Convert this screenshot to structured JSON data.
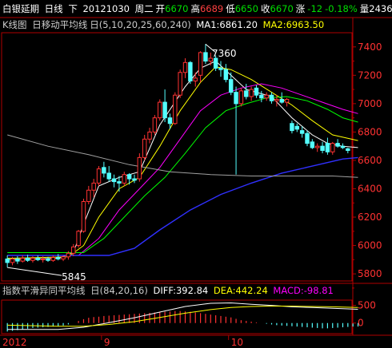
{
  "header": {
    "symbol": "白银延期",
    "period": "日线",
    "direction": "下",
    "date": "20121030",
    "weekday": "周二",
    "open_label": "开",
    "open": "6670",
    "high_label": "高",
    "high": "6689",
    "low_label": "低",
    "low": "6650",
    "close_label": "收",
    "close": "6670",
    "change_label": "涨",
    "change": "-12",
    "change_pct": "-0.18%",
    "volume_label": "量2436"
  },
  "main_indicator": {
    "name": "K线图",
    "ma_box": "日",
    "ma_name": "移动平均线",
    "ma_params": "日(5,10,20,25,60,240)",
    "ma1": "MA1:6861.20",
    "ma2": "MA2:6963.50"
  },
  "macd_indicator": {
    "name": "指数平滑异同平均线",
    "params": "日(84,20,16)",
    "diff": "DIFF:392.84",
    "dea": "DEA:442.24",
    "macd": "MACD:-98.81"
  },
  "colors": {
    "up": "#ff3232",
    "down": "#54ffff",
    "frame": "#b00000",
    "ma5": "#ffffff",
    "ma10": "#ffff00",
    "ma20": "#ff00ff",
    "ma25": "#00ff00",
    "ma60": "#3030ff",
    "ma240": "#a0a0a0"
  },
  "chart_data": {
    "type": "candlestick",
    "price_axis": {
      "range": [
        5750,
        7500
      ],
      "ticks": [
        "7400",
        "7200",
        "7000",
        "6800",
        "6600",
        "6400",
        "6200",
        "6000",
        "5800"
      ]
    },
    "macd_axis": {
      "range": [
        -300,
        650
      ],
      "ticks": [
        "500",
        "0"
      ]
    },
    "x_ticks": [
      "2012",
      "9",
      "10"
    ],
    "annotations": {
      "high": "7360",
      "low": "5845"
    },
    "candles": [
      {
        "o": 5905,
        "h": 5930,
        "l": 5845,
        "c": 5880
      },
      {
        "o": 5880,
        "h": 5920,
        "l": 5860,
        "c": 5905
      },
      {
        "o": 5905,
        "h": 5925,
        "l": 5870,
        "c": 5890
      },
      {
        "o": 5890,
        "h": 5930,
        "l": 5880,
        "c": 5910
      },
      {
        "o": 5910,
        "h": 5935,
        "l": 5885,
        "c": 5895
      },
      {
        "o": 5895,
        "h": 5925,
        "l": 5880,
        "c": 5910
      },
      {
        "o": 5910,
        "h": 5930,
        "l": 5890,
        "c": 5900
      },
      {
        "o": 5900,
        "h": 5925,
        "l": 5880,
        "c": 5905
      },
      {
        "o": 5905,
        "h": 5920,
        "l": 5885,
        "c": 5895
      },
      {
        "o": 5895,
        "h": 5930,
        "l": 5885,
        "c": 5915
      },
      {
        "o": 5915,
        "h": 5940,
        "l": 5895,
        "c": 5905
      },
      {
        "o": 5905,
        "h": 5930,
        "l": 5890,
        "c": 5920
      },
      {
        "o": 5920,
        "h": 5960,
        "l": 5900,
        "c": 5945
      },
      {
        "o": 5945,
        "h": 6010,
        "l": 5925,
        "c": 5990
      },
      {
        "o": 6000,
        "h": 6110,
        "l": 5985,
        "c": 6100
      },
      {
        "o": 6100,
        "h": 6330,
        "l": 6090,
        "c": 6310
      },
      {
        "o": 6310,
        "h": 6420,
        "l": 6290,
        "c": 6390
      },
      {
        "o": 6390,
        "h": 6470,
        "l": 6340,
        "c": 6440
      },
      {
        "o": 6440,
        "h": 6560,
        "l": 6420,
        "c": 6540
      },
      {
        "o": 6550,
        "h": 6590,
        "l": 6480,
        "c": 6510
      },
      {
        "o": 6510,
        "h": 6560,
        "l": 6450,
        "c": 6470
      },
      {
        "o": 6470,
        "h": 6500,
        "l": 6410,
        "c": 6450
      },
      {
        "o": 6450,
        "h": 6490,
        "l": 6380,
        "c": 6440
      },
      {
        "o": 6440,
        "h": 6520,
        "l": 6420,
        "c": 6500
      },
      {
        "o": 6500,
        "h": 6510,
        "l": 6430,
        "c": 6470
      },
      {
        "o": 6470,
        "h": 6500,
        "l": 6440,
        "c": 6460
      },
      {
        "o": 6470,
        "h": 6650,
        "l": 6450,
        "c": 6620
      },
      {
        "o": 6620,
        "h": 6780,
        "l": 6600,
        "c": 6750
      },
      {
        "o": 6750,
        "h": 6830,
        "l": 6720,
        "c": 6800
      },
      {
        "o": 6800,
        "h": 6920,
        "l": 6780,
        "c": 6900
      },
      {
        "o": 6900,
        "h": 7030,
        "l": 6880,
        "c": 7010
      },
      {
        "o": 7010,
        "h": 7100,
        "l": 6870,
        "c": 6900
      },
      {
        "o": 6900,
        "h": 6930,
        "l": 6820,
        "c": 6860
      },
      {
        "o": 6860,
        "h": 7080,
        "l": 6850,
        "c": 7060
      },
      {
        "o": 7060,
        "h": 7240,
        "l": 7040,
        "c": 7220
      },
      {
        "o": 7220,
        "h": 7320,
        "l": 7180,
        "c": 7290
      },
      {
        "o": 7290,
        "h": 7300,
        "l": 7140,
        "c": 7160
      },
      {
        "o": 7160,
        "h": 7220,
        "l": 7120,
        "c": 7180
      },
      {
        "o": 7200,
        "h": 7370,
        "l": 7150,
        "c": 7360
      },
      {
        "o": 7360,
        "h": 7420,
        "l": 7280,
        "c": 7300
      },
      {
        "o": 7300,
        "h": 7360,
        "l": 7270,
        "c": 7320
      },
      {
        "o": 7320,
        "h": 7340,
        "l": 7230,
        "c": 7250
      },
      {
        "o": 7250,
        "h": 7300,
        "l": 7190,
        "c": 7240
      },
      {
        "o": 7240,
        "h": 7280,
        "l": 7150,
        "c": 7170
      },
      {
        "o": 7170,
        "h": 7220,
        "l": 7060,
        "c": 7080
      },
      {
        "o": 7080,
        "h": 7120,
        "l": 6500,
        "c": 7000
      },
      {
        "o": 7000,
        "h": 7110,
        "l": 6980,
        "c": 7090
      },
      {
        "o": 7090,
        "h": 7140,
        "l": 7030,
        "c": 7050
      },
      {
        "o": 7050,
        "h": 7120,
        "l": 7020,
        "c": 7100
      },
      {
        "o": 7110,
        "h": 7130,
        "l": 7040,
        "c": 7060
      },
      {
        "o": 7060,
        "h": 7090,
        "l": 7010,
        "c": 7040
      },
      {
        "o": 7040,
        "h": 7080,
        "l": 7020,
        "c": 7060
      },
      {
        "o": 7060,
        "h": 7080,
        "l": 7000,
        "c": 7020
      },
      {
        "o": 7020,
        "h": 7060,
        "l": 6980,
        "c": 7030
      },
      {
        "o": 7030,
        "h": 7080,
        "l": 7000,
        "c": 7010
      },
      {
        "o": 7010,
        "h": 7040,
        "l": 6980,
        "c": 7030
      },
      {
        "o": 6860,
        "h": 6880,
        "l": 6790,
        "c": 6810
      },
      {
        "o": 6840,
        "h": 6860,
        "l": 6800,
        "c": 6820
      },
      {
        "o": 6810,
        "h": 6840,
        "l": 6760,
        "c": 6790
      },
      {
        "o": 6790,
        "h": 6810,
        "l": 6700,
        "c": 6720
      },
      {
        "o": 6730,
        "h": 6750,
        "l": 6680,
        "c": 6690
      },
      {
        "o": 6690,
        "h": 6720,
        "l": 6660,
        "c": 6700
      },
      {
        "o": 6700,
        "h": 6730,
        "l": 6650,
        "c": 6670
      },
      {
        "o": 6720,
        "h": 6760,
        "l": 6640,
        "c": 6660
      },
      {
        "o": 6660,
        "h": 6730,
        "l": 6640,
        "c": 6720
      },
      {
        "o": 6720,
        "h": 6750,
        "l": 6690,
        "c": 6700
      },
      {
        "o": 6700,
        "h": 6720,
        "l": 6680,
        "c": 6690
      },
      {
        "o": 6682,
        "h": 6689,
        "l": 6650,
        "c": 6670
      }
    ],
    "ma_lines": {
      "ma5": [
        [
          0,
          5900
        ],
        [
          10,
          5910
        ],
        [
          13,
          5950
        ],
        [
          15,
          6150
        ],
        [
          18,
          6420
        ],
        [
          22,
          6480
        ],
        [
          26,
          6520
        ],
        [
          30,
          6850
        ],
        [
          35,
          7120
        ],
        [
          38,
          7250
        ],
        [
          41,
          7300
        ],
        [
          44,
          7200
        ],
        [
          47,
          7100
        ],
        [
          52,
          7050
        ],
        [
          56,
          6900
        ],
        [
          60,
          6780
        ],
        [
          63,
          6720
        ],
        [
          66,
          6700
        ],
        [
          69,
          6690
        ]
      ],
      "ma10": [
        [
          0,
          5910
        ],
        [
          12,
          5920
        ],
        [
          15,
          6000
        ],
        [
          18,
          6200
        ],
        [
          22,
          6400
        ],
        [
          26,
          6480
        ],
        [
          30,
          6700
        ],
        [
          34,
          6950
        ],
        [
          38,
          7150
        ],
        [
          41,
          7260
        ],
        [
          44,
          7240
        ],
        [
          48,
          7170
        ],
        [
          52,
          7080
        ],
        [
          56,
          6990
        ],
        [
          60,
          6880
        ],
        [
          64,
          6780
        ],
        [
          69,
          6740
        ]
      ],
      "ma20": [
        [
          0,
          5930
        ],
        [
          14,
          5930
        ],
        [
          18,
          6050
        ],
        [
          22,
          6250
        ],
        [
          26,
          6400
        ],
        [
          30,
          6550
        ],
        [
          34,
          6750
        ],
        [
          38,
          6950
        ],
        [
          42,
          7060
        ],
        [
          46,
          7110
        ],
        [
          50,
          7140
        ],
        [
          54,
          7110
        ],
        [
          58,
          7060
        ],
        [
          62,
          7010
        ],
        [
          66,
          6960
        ],
        [
          69,
          6930
        ]
      ],
      "ma25": [
        [
          0,
          5950
        ],
        [
          15,
          5950
        ],
        [
          19,
          6050
        ],
        [
          23,
          6200
        ],
        [
          27,
          6350
        ],
        [
          31,
          6480
        ],
        [
          35,
          6650
        ],
        [
          39,
          6830
        ],
        [
          43,
          6950
        ],
        [
          47,
          7000
        ],
        [
          51,
          7040
        ],
        [
          55,
          7050
        ],
        [
          59,
          7020
        ],
        [
          63,
          6960
        ],
        [
          66,
          6900
        ],
        [
          69,
          6870
        ]
      ],
      "ma60": [
        [
          0,
          5930
        ],
        [
          20,
          5930
        ],
        [
          25,
          5980
        ],
        [
          30,
          6110
        ],
        [
          36,
          6250
        ],
        [
          42,
          6360
        ],
        [
          48,
          6440
        ],
        [
          54,
          6510
        ],
        [
          60,
          6560
        ],
        [
          66,
          6610
        ],
        [
          69,
          6620
        ]
      ],
      "ma240": [
        [
          0,
          6780
        ],
        [
          8,
          6700
        ],
        [
          16,
          6640
        ],
        [
          24,
          6570
        ],
        [
          32,
          6520
        ],
        [
          40,
          6500
        ],
        [
          48,
          6490
        ],
        [
          56,
          6490
        ],
        [
          64,
          6490
        ],
        [
          69,
          6480
        ]
      ]
    },
    "macd_lines": {
      "diff": [
        [
          0,
          -180
        ],
        [
          10,
          -180
        ],
        [
          15,
          -120
        ],
        [
          20,
          10
        ],
        [
          25,
          150
        ],
        [
          30,
          310
        ],
        [
          35,
          470
        ],
        [
          40,
          560
        ],
        [
          44,
          570
        ],
        [
          48,
          530
        ],
        [
          52,
          500
        ],
        [
          56,
          460
        ],
        [
          60,
          440
        ],
        [
          64,
          420
        ],
        [
          69,
          390
        ]
      ],
      "dea": [
        [
          0,
          -60
        ],
        [
          10,
          -90
        ],
        [
          15,
          -90
        ],
        [
          20,
          -40
        ],
        [
          25,
          40
        ],
        [
          30,
          160
        ],
        [
          35,
          280
        ],
        [
          40,
          380
        ],
        [
          44,
          440
        ],
        [
          48,
          470
        ],
        [
          52,
          480
        ],
        [
          56,
          480
        ],
        [
          60,
          470
        ],
        [
          64,
          460
        ],
        [
          69,
          440
        ]
      ]
    },
    "macd_hist": [
      -240,
      -220,
      -200,
      -180,
      -160,
      -140,
      -130,
      -120,
      -110,
      -100,
      -90,
      -70,
      -40,
      0,
      60,
      110,
      150,
      170,
      180,
      200,
      210,
      220,
      230,
      240,
      250,
      260,
      270,
      280,
      290,
      300,
      310,
      320,
      330,
      340,
      340,
      330,
      320,
      300,
      280,
      260,
      240,
      220,
      200,
      180,
      160,
      120,
      80,
      60,
      40,
      20,
      0,
      -20,
      -40,
      -60,
      -70,
      -80,
      -90,
      -100,
      -110,
      -120,
      -130,
      -140,
      -150,
      -150,
      -140,
      -130,
      -120,
      -110,
      -100,
      -99
    ]
  }
}
